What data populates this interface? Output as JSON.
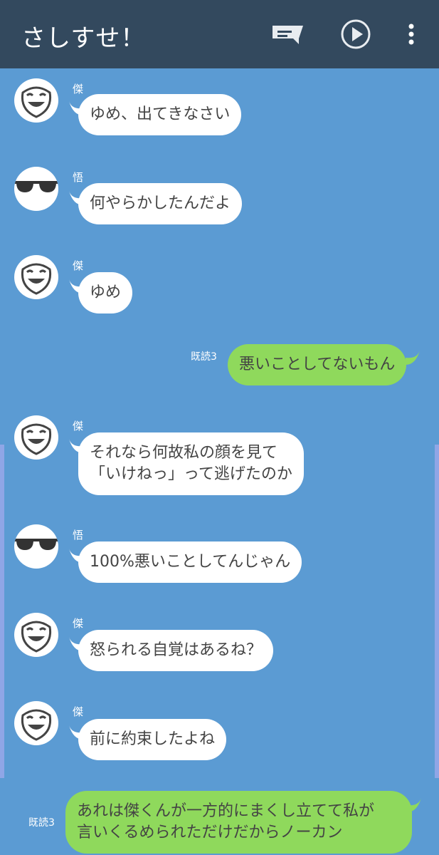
{
  "header": {
    "title": "さしすせ！",
    "icons": [
      "chat-list-icon",
      "play-icon",
      "more-vert-icon"
    ]
  },
  "colors": {
    "header_bg": "#33495e",
    "chat_bg": "#5b9bd3",
    "incoming_bubble": "#ffffff",
    "outgoing_bubble": "#8fd95c",
    "text": "#444444"
  },
  "messages": [
    {
      "sender": "傑",
      "avatar": "smile-mask-icon",
      "text": "ゆめ、出てきなさい"
    },
    {
      "sender": "悟",
      "avatar": "sunglasses-icon",
      "text": "何やらかしたんだよ"
    },
    {
      "sender": "傑",
      "avatar": "smile-mask-icon",
      "text": "ゆめ"
    },
    {
      "read": "既読3",
      "text": "悪いことしてないもん"
    },
    {
      "sender": "傑",
      "avatar": "smile-mask-icon",
      "lines": [
        "それなら何故私の顔を見て",
        "「いけねっ」って逃げたのか"
      ]
    },
    {
      "sender": "悟",
      "avatar": "sunglasses-icon",
      "text": "100%悪いことしてんじゃん"
    },
    {
      "sender": "傑",
      "avatar": "smile-mask-icon",
      "text": "怒られる自覚はあるね？"
    },
    {
      "sender": "傑",
      "avatar": "smile-mask-icon",
      "text": "前に約束したよね"
    },
    {
      "read": "既読3",
      "lines": [
        "あれは傑くんが一方的にまくし立てて私が",
        "言いくるめられただけだからノーカン"
      ]
    }
  ]
}
